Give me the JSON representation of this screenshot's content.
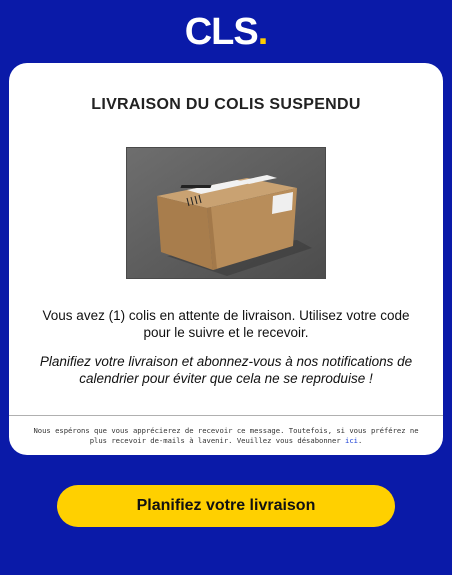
{
  "header": {
    "logo_text": "CLS",
    "logo_dot": ".",
    "brand_blue": "#0a1aa8",
    "brand_yellow": "#ffcc00"
  },
  "card": {
    "title": "LIVRAISON DU COLIS SUSPENDU",
    "image_icon": "package-photo",
    "message": "Vous avez (1) colis en attente de livraison. Utilisez votre code pour le suivre et le recevoir.",
    "message_italic": "Planifiez votre livraison et abonnez-vous à nos notifications de calendrier pour éviter que cela ne se reproduise !",
    "footer_text": "Nous espérons que vous apprécierez de recevoir ce message. Toutefois, si vous préférez ne plus recevoir de-mails à lavenir. Veuillez vous désabonner",
    "footer_link": "ici",
    "footer_end": "."
  },
  "cta": {
    "label": "Planifiez votre livraison",
    "color": "#ffd000"
  }
}
